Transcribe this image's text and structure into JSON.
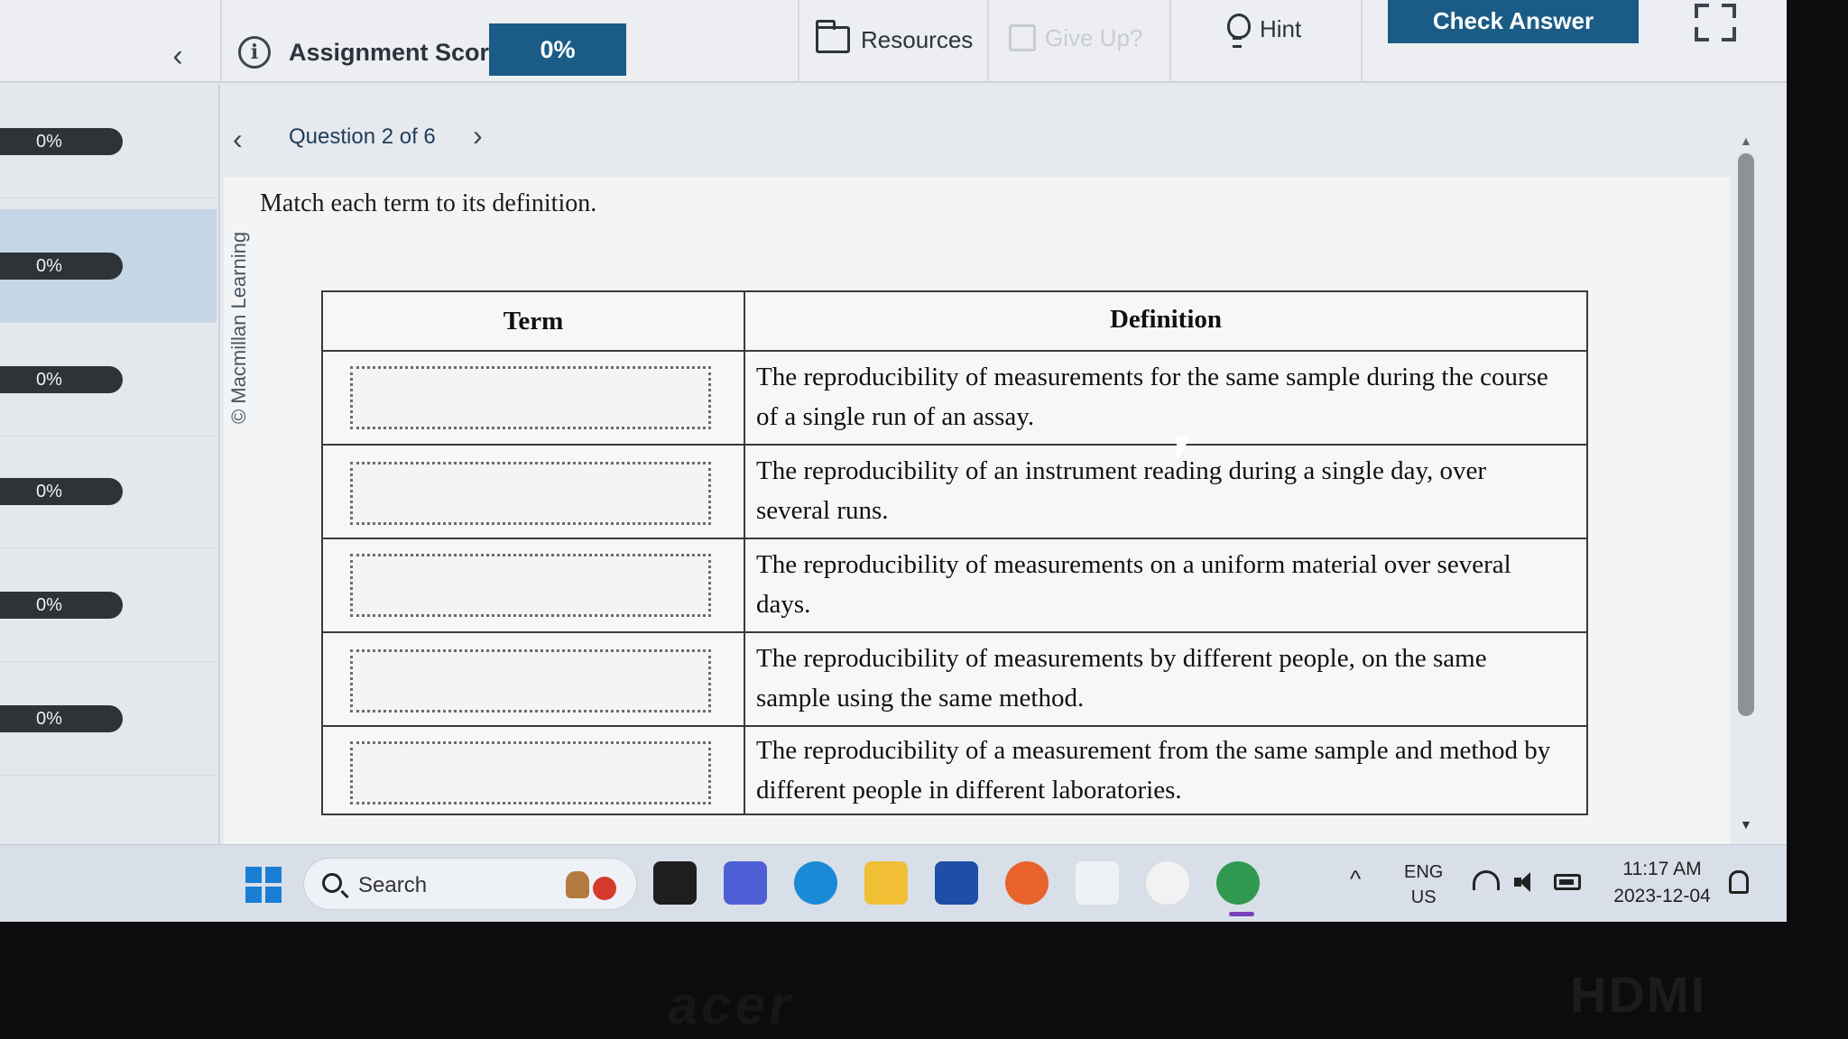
{
  "topbar": {
    "collapse_glyph": "‹",
    "score_label": "Assignment Score:",
    "score_value": "0%",
    "resources_label": "Resources",
    "giveup_label": "Give Up?",
    "hint_label": "Hint",
    "check_label": "Check Answer"
  },
  "sidebar": {
    "items": [
      {
        "score": "0%",
        "active": false
      },
      {
        "score": "0%",
        "active": true
      },
      {
        "score": "0%",
        "active": false
      },
      {
        "score": "0%",
        "active": false
      },
      {
        "score": "0%",
        "active": false
      },
      {
        "score": "0%",
        "active": false
      }
    ]
  },
  "question_nav": {
    "prev_glyph": "‹",
    "label": "Question 2 of 6",
    "next_glyph": "›"
  },
  "copyright": "© Macmillan Learning",
  "prompt": "Match each term to its definition.",
  "table": {
    "headers": {
      "term": "Term",
      "definition": "Definition"
    },
    "rows": [
      {
        "definition": "The reproducibility of measurements for the same sample during the course of a single run of an assay."
      },
      {
        "definition": "The reproducibility of an instrument reading during a single day, over several runs."
      },
      {
        "definition": "The reproducibility of measurements on a uniform material over several days."
      },
      {
        "definition": "The reproducibility of measurements by different people, on the same sample using the same method."
      },
      {
        "definition": "The reproducibility of a measurement from the same sample and method by different people in different laboratories."
      }
    ]
  },
  "taskbar": {
    "search_label": "Search",
    "lang_line1": "ENG",
    "lang_line2": "US",
    "time": "11:17 AM",
    "date": "2023-12-04",
    "tray_glyph": "^",
    "apps": [
      {
        "name": "file-explorer-dark-icon",
        "color": "#1e1e1e"
      },
      {
        "name": "meet-icon",
        "color": "#4e5fd6"
      },
      {
        "name": "edge-icon",
        "color": "#1b8ad6"
      },
      {
        "name": "folder-icon",
        "color": "#f0bf35"
      },
      {
        "name": "store-icon",
        "color": "#1d4fa8"
      },
      {
        "name": "firefox-icon",
        "color": "#e8622c"
      },
      {
        "name": "amazon-icon",
        "color": "#eef2f7"
      },
      {
        "name": "shield-app-icon",
        "color": "#f2f2f2"
      },
      {
        "name": "chrome-icon",
        "color": "#2f9a4f"
      }
    ]
  },
  "bezel": {
    "brand": "acer",
    "hdmi": "HDMI"
  },
  "colors": {
    "accent": "#1b5c86",
    "active_row": "#c5d6e6"
  }
}
